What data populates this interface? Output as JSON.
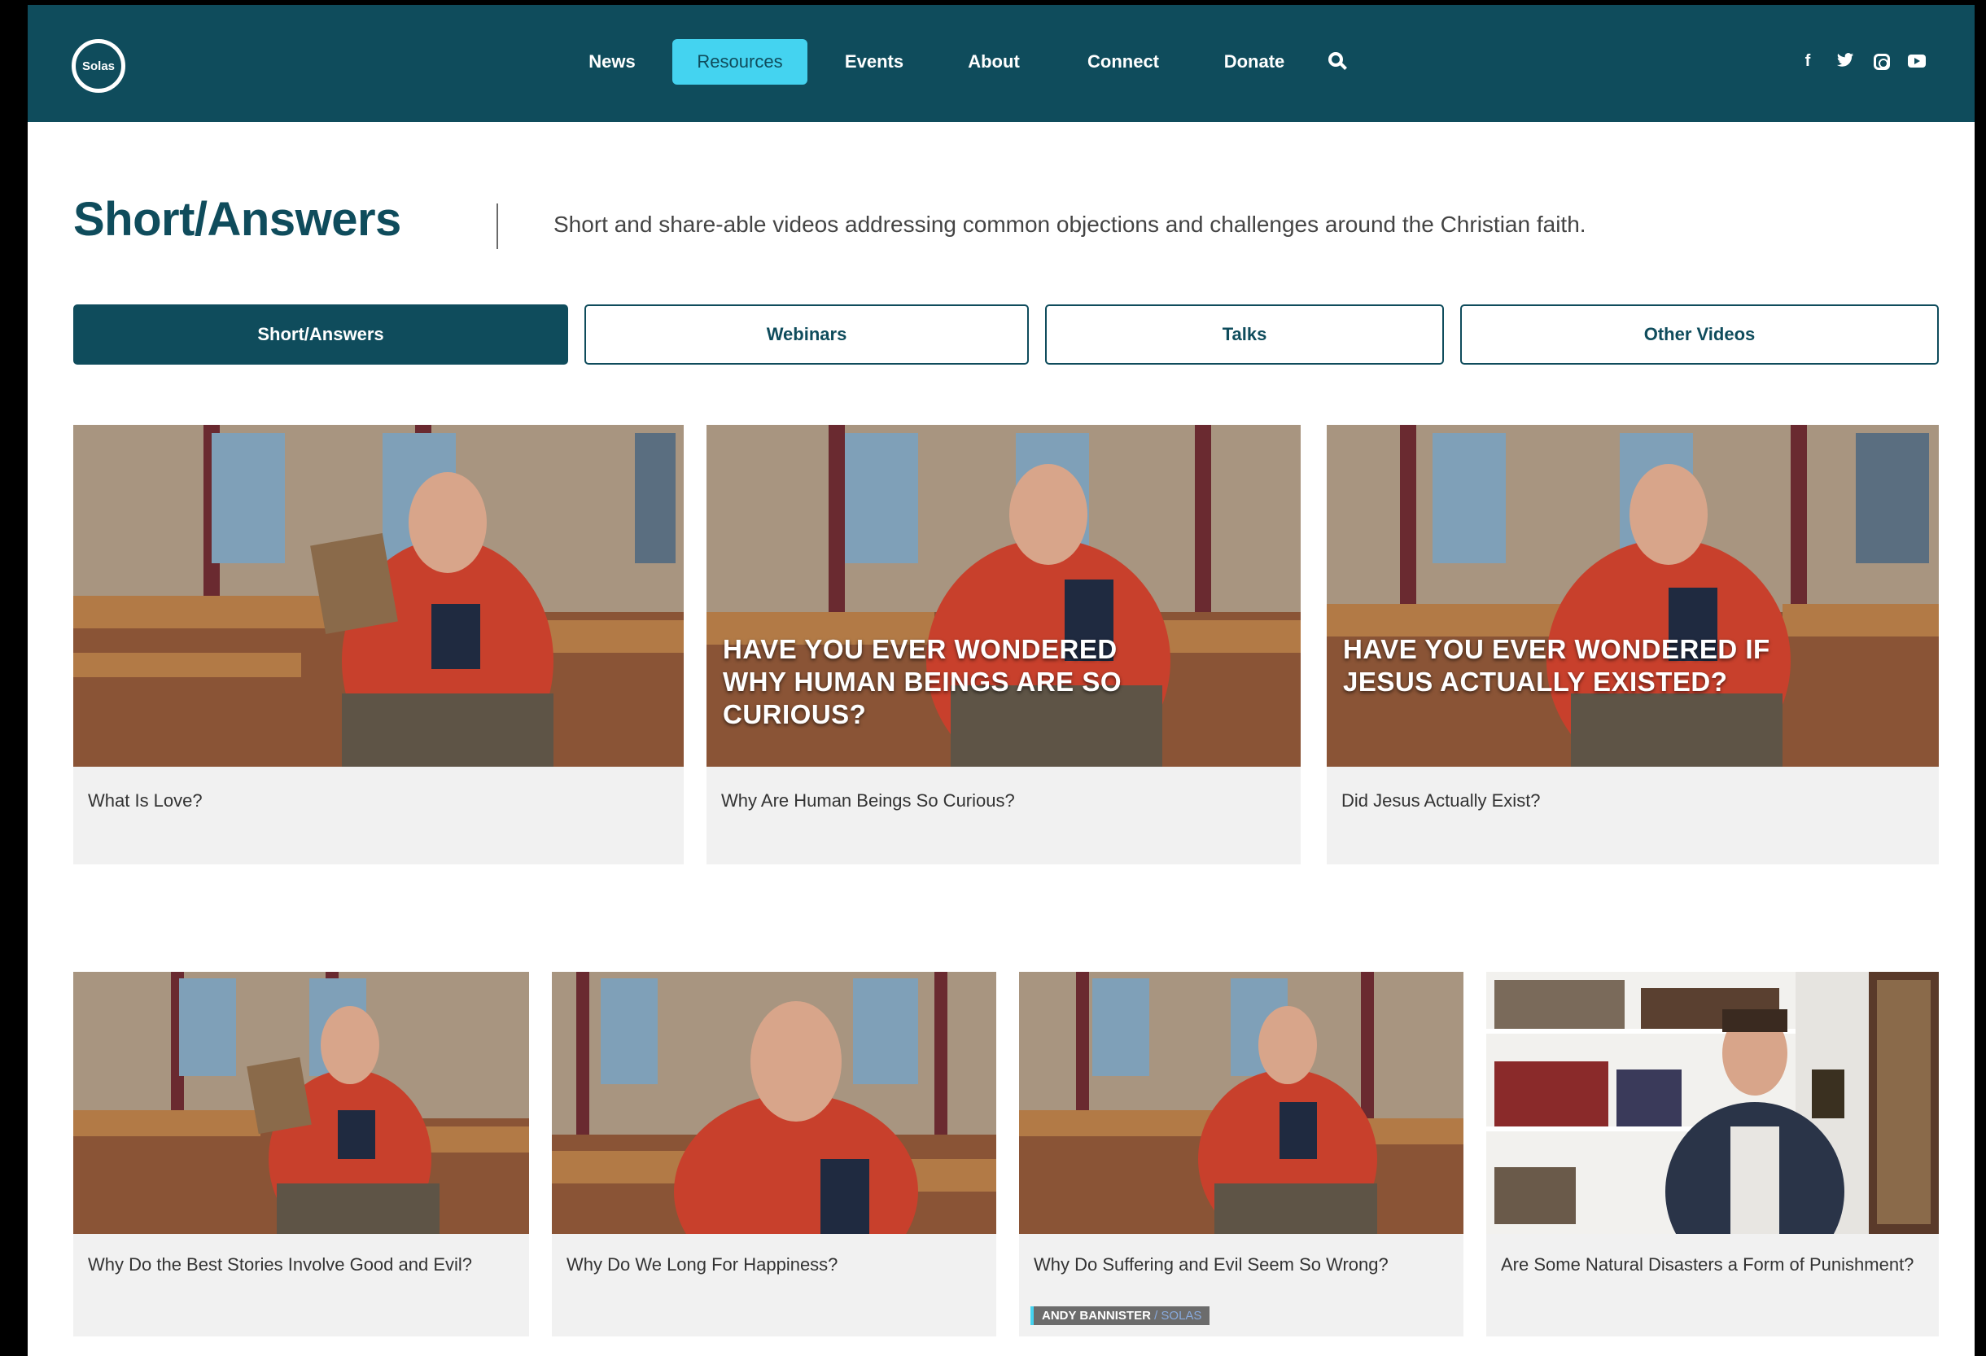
{
  "logo": {
    "text": "Solas"
  },
  "nav": {
    "items": [
      "News",
      "Resources",
      "Events",
      "About",
      "Connect",
      "Donate"
    ],
    "active": "Resources"
  },
  "social": [
    "facebook-icon",
    "twitter-icon",
    "instagram-icon",
    "youtube-icon"
  ],
  "colors": {
    "primary": "#0f4c5c",
    "accent": "#44d3f0",
    "card_bg": "#f1f1f1"
  },
  "page": {
    "title": "Short/Answers",
    "subtitle": "Short and share-able videos addressing common objections and challenges around the Christian faith."
  },
  "tabs": [
    "Short/Answers",
    "Webinars",
    "Talks",
    "Other Videos"
  ],
  "cards": [
    {
      "title": "What Is Love?",
      "overlay": ""
    },
    {
      "title": "Why Are Human Beings So Curious?",
      "overlay": "HAVE YOU EVER WONDERED WHY HUMAN BEINGS ARE SO CURIOUS?"
    },
    {
      "title": "Did Jesus Actually Exist?",
      "overlay": "HAVE YOU EVER WONDERED IF JESUS ACTUALLY EXISTED?"
    },
    {
      "title": "Why Do the Best Stories Involve Good and Evil?",
      "overlay": ""
    },
    {
      "title": "Why Do We Long For Happiness?",
      "overlay": ""
    },
    {
      "title": "Why Do Suffering and Evil Seem So Wrong?",
      "overlay": "",
      "name_tag": "ANDY BANNISTER",
      "name_tag_org": "/ SOLAS"
    },
    {
      "title": "Are Some Natural Disasters a Form of Punishment?",
      "overlay": ""
    }
  ]
}
